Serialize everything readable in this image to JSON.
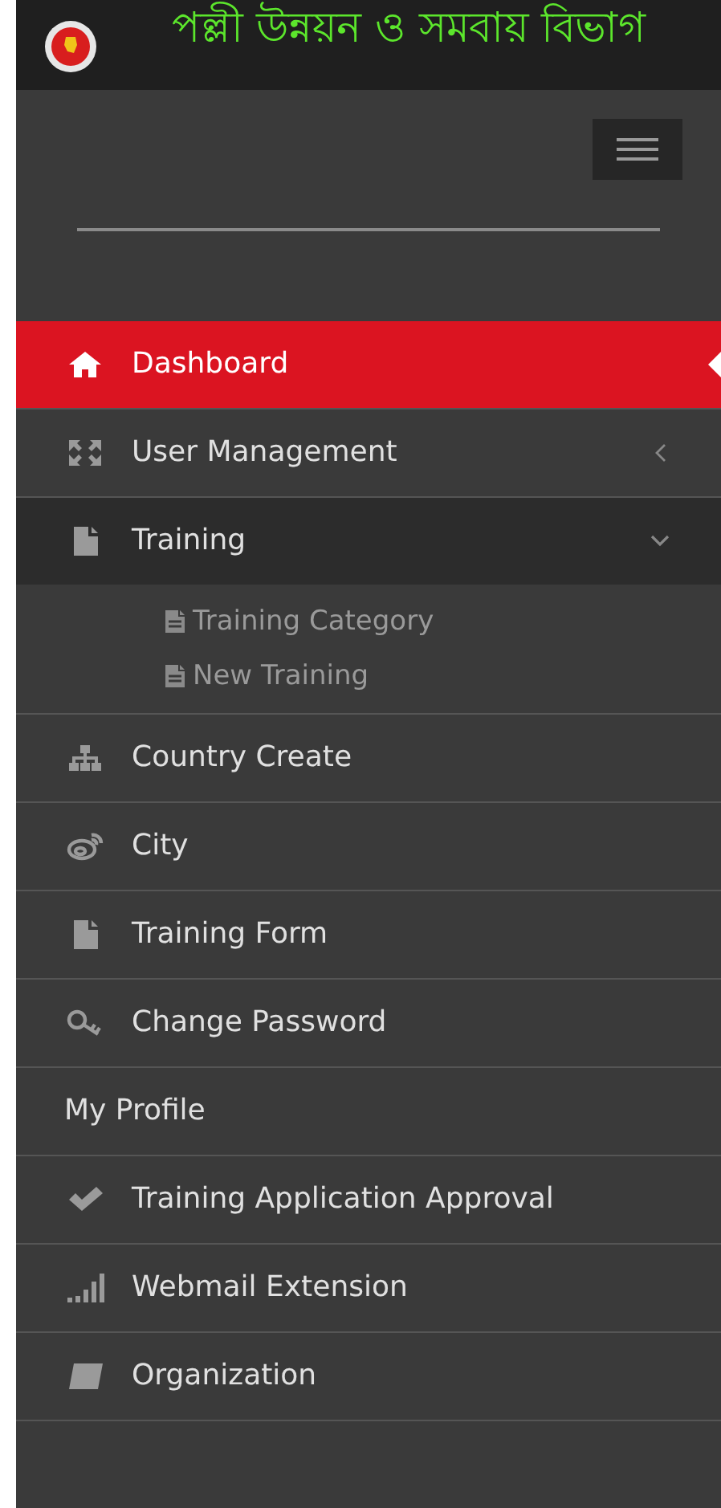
{
  "header": {
    "title": "পল্লী উন্নয়ন ও সমবায় বিভাগ"
  },
  "menu": [
    {
      "label": "Dashboard",
      "kind": "home",
      "selected": true
    },
    {
      "label": "User Management",
      "kind": "arrows",
      "selected": false,
      "expanded": false
    },
    {
      "label": "Training",
      "kind": "file",
      "selected": false,
      "expanded": true,
      "children": [
        {
          "label": "Training Category"
        },
        {
          "label": "New Training"
        }
      ]
    },
    {
      "label": "Country Create",
      "kind": "sitemap",
      "selected": false
    },
    {
      "label": "City",
      "kind": "weibo",
      "selected": false
    },
    {
      "label": "Training Form",
      "kind": "file",
      "selected": false
    },
    {
      "label": "Change Password",
      "kind": "key",
      "selected": false
    },
    {
      "label": "My Profile",
      "kind": "none",
      "selected": false
    },
    {
      "label": "Training Application Approval",
      "kind": "check",
      "selected": false
    },
    {
      "label": "Webmail Extension",
      "kind": "signal",
      "selected": false
    },
    {
      "label": "Organization",
      "kind": "book",
      "selected": false
    }
  ]
}
